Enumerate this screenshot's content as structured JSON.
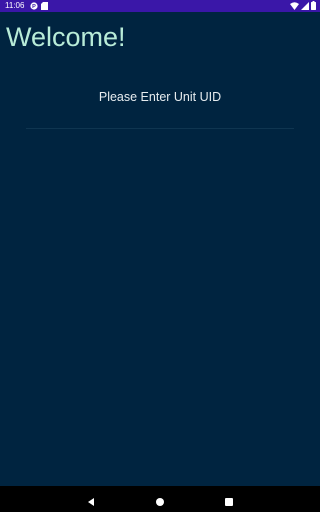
{
  "status_bar": {
    "time": "11:06",
    "background_color": "#3a17a8",
    "icons": [
      "notification-p-icon",
      "sd-card-icon",
      "wifi-icon",
      "signal-icon",
      "battery-icon"
    ]
  },
  "main": {
    "title": "Welcome!",
    "prompt": "Please Enter Unit UID",
    "uid_input": {
      "value": "",
      "placeholder": ""
    },
    "background_color": "#002440",
    "title_color": "#b8ecd8"
  },
  "nav_bar": {
    "icons": [
      "back-icon",
      "home-icon",
      "recents-icon"
    ]
  }
}
